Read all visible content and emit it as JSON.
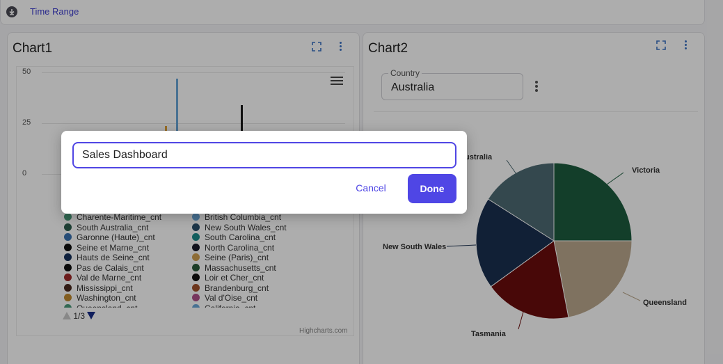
{
  "toolbar": {
    "time_range_label": "Time Range",
    "icon": "download-circle-icon"
  },
  "chart1": {
    "title": "Chart1",
    "legend_page": "1/3",
    "credits": "Highcharts.com",
    "chart_data": {
      "type": "bar",
      "yticks": [
        "50",
        "25",
        "0"
      ],
      "ylim": [
        0,
        50
      ],
      "visible_bars": [
        {
          "value": 23.5,
          "color": "#e0a23a"
        },
        {
          "value": 47,
          "color": "#6aa7d8"
        },
        {
          "value": 34,
          "color": "#1a1a1a"
        }
      ],
      "legend": [
        {
          "label": "Charente-Maritime_cnt",
          "color": "#4a9a7a"
        },
        {
          "label": "South Australia_cnt",
          "color": "#2f5f4f"
        },
        {
          "label": "Garonne (Haute)_cnt",
          "color": "#3a72b0"
        },
        {
          "label": "Seine et Marne_cnt",
          "color": "#111111"
        },
        {
          "label": "Hauts de Seine_cnt",
          "color": "#15305a"
        },
        {
          "label": "Pas de Calais_cnt",
          "color": "#111111"
        },
        {
          "label": "Val de Marne_cnt",
          "color": "#a02a2a"
        },
        {
          "label": "Mississippi_cnt",
          "color": "#4a2a20"
        },
        {
          "label": "Washington_cnt",
          "color": "#c08a30"
        },
        {
          "label": "Queensland_cnt",
          "color": "#4a9a7a"
        },
        {
          "label": "British Columbia_cnt",
          "color": "#6aa7d8"
        },
        {
          "label": "New South Wales_cnt",
          "color": "#2a4f6a"
        },
        {
          "label": "South Carolina_cnt",
          "color": "#1a8a8a"
        },
        {
          "label": "North Carolina_cnt",
          "color": "#1a1a2a"
        },
        {
          "label": "Seine (Paris)_cnt",
          "color": "#d0a050"
        },
        {
          "label": "Massachusetts_cnt",
          "color": "#2a5a3a"
        },
        {
          "label": "Loir et Cher_cnt",
          "color": "#111111"
        },
        {
          "label": "Brandenburg_cnt",
          "color": "#a0502a"
        },
        {
          "label": "Val d'Oise_cnt",
          "color": "#b0508a"
        },
        {
          "label": "California_cnt",
          "color": "#6aa7d8"
        }
      ]
    }
  },
  "chart2": {
    "title": "Chart2",
    "country_label": "Country",
    "country_value": "Australia",
    "chart_data": {
      "type": "pie",
      "slices": [
        {
          "name": "Victoria",
          "value": 25,
          "color": "#1d5c3e"
        },
        {
          "name": "Queensland",
          "value": 22,
          "color": "#bba98e"
        },
        {
          "name": "Tasmania",
          "value": 18,
          "color": "#6b0d0d"
        },
        {
          "name": "New South Wales",
          "value": 19,
          "color": "#1a3050"
        },
        {
          "name": "South Australia",
          "value": 16,
          "color": "#4d6b73"
        }
      ],
      "visible_label_text": {
        "South Australia": "ustralia"
      }
    }
  },
  "dialog": {
    "input_value": "Sales Dashboard",
    "cancel_label": "Cancel",
    "done_label": "Done"
  }
}
